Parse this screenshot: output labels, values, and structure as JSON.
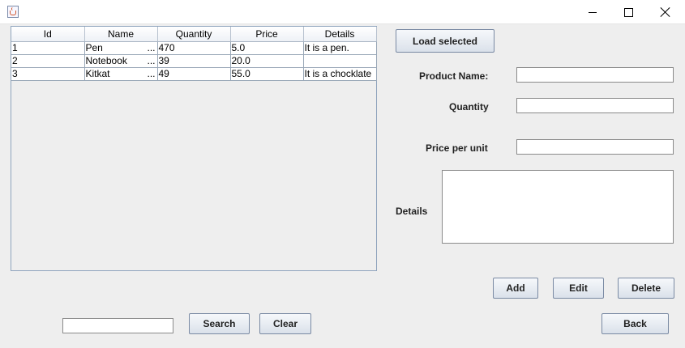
{
  "window": {
    "icon": "java-icon"
  },
  "table": {
    "columns": [
      "Id",
      "Name",
      "Quantity",
      "Price",
      "Details"
    ],
    "rows": [
      {
        "id": "1",
        "name": "Pen",
        "quantity": "470",
        "price": "5.0",
        "details": "It is a pen."
      },
      {
        "id": "2",
        "name": "Notebook",
        "quantity": "39",
        "price": "20.0",
        "details": ""
      },
      {
        "id": "3",
        "name": "Kitkat",
        "quantity": "49",
        "price": "55.0",
        "details": "It is a chocklate"
      }
    ],
    "ellipsis": "..."
  },
  "form": {
    "load_selected_label": "Load selected",
    "product_name_label": "Product Name:",
    "product_name_value": "",
    "quantity_label": "Quantity",
    "quantity_value": "",
    "price_label": "Price per unit",
    "price_value": "",
    "details_label": "Details",
    "details_value": ""
  },
  "actions": {
    "add": "Add",
    "edit": "Edit",
    "delete": "Delete",
    "back": "Back"
  },
  "search": {
    "value": "",
    "search_label": "Search",
    "clear_label": "Clear"
  }
}
